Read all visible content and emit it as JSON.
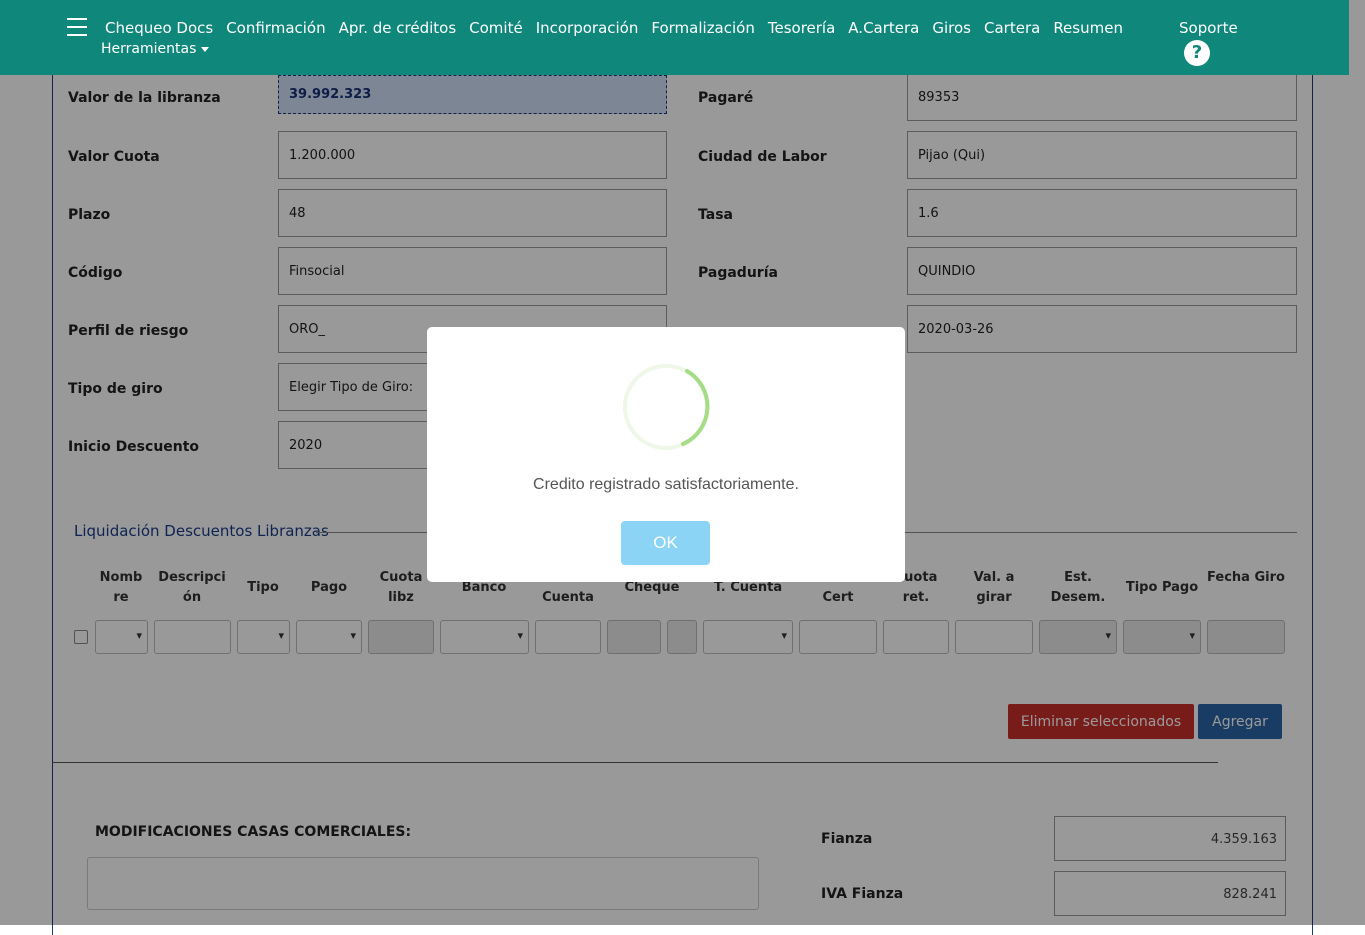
{
  "navbar": {
    "links": [
      "Chequeo Docs",
      "Confirmación",
      "Apr. de créditos",
      "Comité",
      "Incorporación",
      "Formalización",
      "Tesorería",
      "A.Cartera",
      "Giros",
      "Cartera",
      "Resumen"
    ],
    "tools": "Herramientas",
    "support": "Soporte",
    "help_icon": "?"
  },
  "form": {
    "valor_libranza": {
      "label": "Valor de la libranza",
      "value": "39.992.323"
    },
    "valor_cuota": {
      "label": "Valor Cuota",
      "value": "1.200.000"
    },
    "plazo": {
      "label": "Plazo",
      "value": "48"
    },
    "codigo": {
      "label": "Código",
      "value": "Finsocial"
    },
    "perfil": {
      "label": "Perfil de riesgo",
      "value": "ORO_"
    },
    "tipo_giro": {
      "label": "Tipo de giro",
      "value": "Elegir Tipo de Giro:"
    },
    "inicio_descuento": {
      "label": "Inicio Descuento",
      "value": "2020"
    },
    "pagare": {
      "label": "Pagaré",
      "value": "89353"
    },
    "ciudad": {
      "label": "Ciudad de Labor",
      "value": "Pijao (Qui)"
    },
    "tasa": {
      "label": "Tasa",
      "value": "1.6"
    },
    "pagaduria": {
      "label": "Pagaduría",
      "value": "QUINDIO"
    },
    "fecha_value": "2020-03-26"
  },
  "liquidacion": {
    "title": "Liquidación Descuentos Libranzas",
    "headers": {
      "nombre": "Nomb re",
      "descripcion": "Descripci ón",
      "tipo": "Tipo",
      "pago": "Pago",
      "cuota_libz": "Cuota libz",
      "banco": "Banco",
      "cuenta": "Cuenta",
      "cheque": "Cheque",
      "t_cuenta": "T. Cuenta",
      "cert": "Cert",
      "cuota_ret": "Cuota ret.",
      "val_girar": "Val. a girar",
      "est_desem": "Est. Desem.",
      "tipo_pago": "Tipo Pago",
      "fecha_giro": "Fecha Giro"
    },
    "delete_button": "Eliminar seleccionados",
    "add_button": "Agregar"
  },
  "modificaciones": {
    "title": "MODIFICACIONES CASAS COMERCIALES:"
  },
  "totals": {
    "fianza": {
      "label": "Fianza",
      "value": "4.359.163"
    },
    "iva_fianza": {
      "label": "IVA Fianza",
      "value": "828.241"
    }
  },
  "modal": {
    "message": "Credito registrado satisfactoriamente.",
    "ok": "OK"
  }
}
